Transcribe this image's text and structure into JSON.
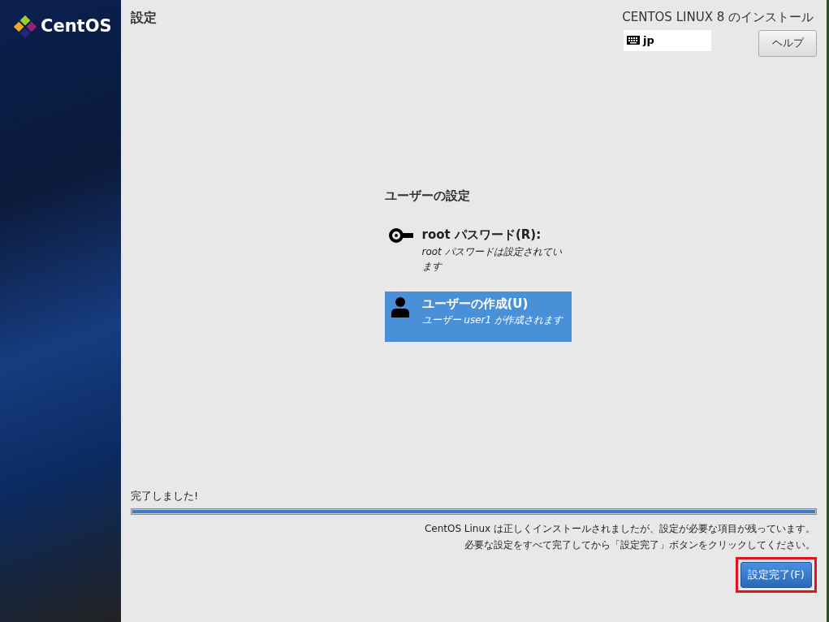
{
  "sidebar": {
    "logo_text": "CentOS"
  },
  "header": {
    "title": "設定",
    "product": "CENTOS LINUX 8 のインストール",
    "keyboard_layout": "jp",
    "help_button": "ヘルプ"
  },
  "section": {
    "title": "ユーザーの設定",
    "items": [
      {
        "kind": "key",
        "title": "root パスワード(R):",
        "status": "root パスワードは設定されています",
        "selected": false
      },
      {
        "kind": "user",
        "title": "ユーザーの作成(U)",
        "status": "ユーザー user1 が作成されます",
        "selected": true
      }
    ]
  },
  "progress": {
    "label": "完了しました!",
    "level": 1.0
  },
  "messages": [
    "CentOS Linux は正しくインストールされましたが、設定が必要な項目が残っています。",
    "必要な設定をすべて完了してから「設定完了」ボタンをクリックしてください。"
  ],
  "finish_button": {
    "label": "設定完了(F)",
    "highlighted": true
  }
}
